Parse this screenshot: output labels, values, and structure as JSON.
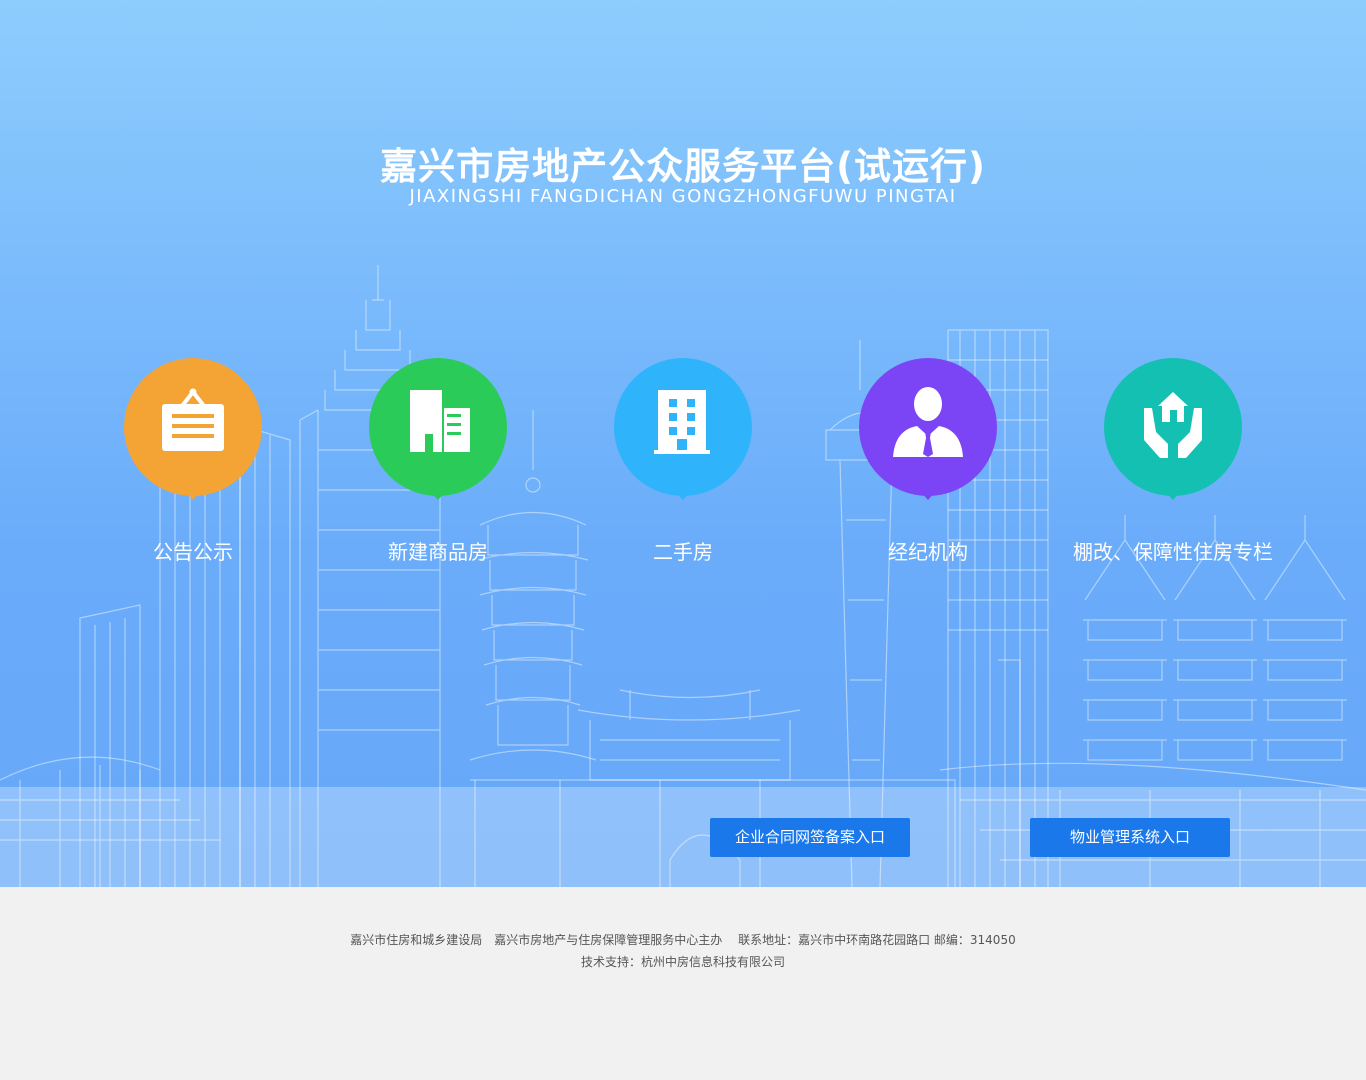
{
  "header": {
    "title": "嘉兴市房地产公众服务平台(试运行)",
    "subtitle": "JIAXINGSHI FANGDICHAN GONGZHONGFUWU PINGTAI"
  },
  "nav": [
    {
      "label": "公告公示",
      "icon": "notice-board-icon",
      "color": "#f3a435"
    },
    {
      "label": "新建商品房",
      "icon": "new-building-icon",
      "color": "#2bcb5a"
    },
    {
      "label": "二手房",
      "icon": "apartment-icon",
      "color": "#2fb4fc"
    },
    {
      "label": "经纪机构",
      "icon": "agent-person-icon",
      "color": "#7b45f5"
    },
    {
      "label": "棚改、保障性住房专栏",
      "icon": "house-in-hands-icon",
      "color": "#14c0b1"
    }
  ],
  "buttons": {
    "contract": "企业合同网签备案入口",
    "property": "物业管理系统入口",
    "color": "#1a78ea"
  },
  "footer": {
    "line1": "嘉兴市住房和城乡建设局　嘉兴市房地产与住房保障管理服务中心主办　 联系地址：嘉兴市中环南路花园路口  邮编：314050",
    "line2": "技术支持：杭州中房信息科技有限公司"
  }
}
